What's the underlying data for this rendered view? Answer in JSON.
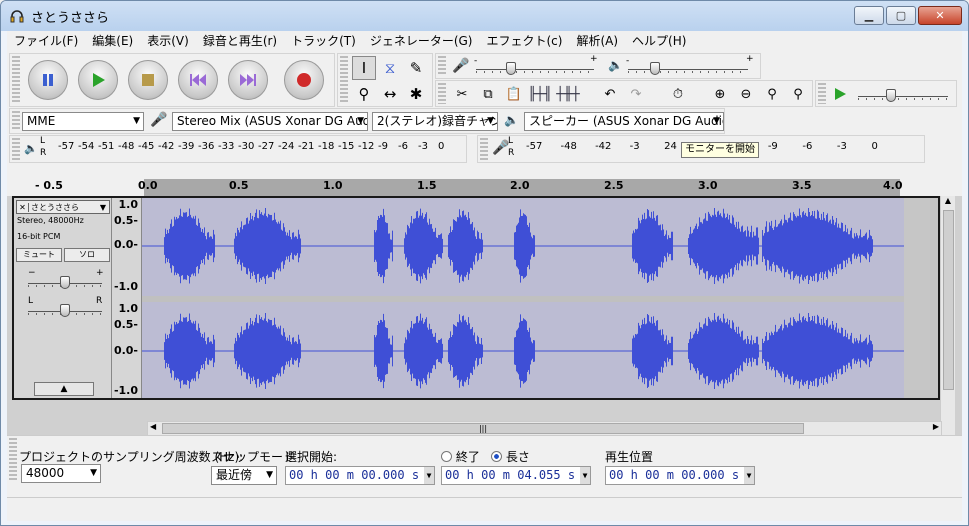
{
  "window": {
    "title": "さとうささら"
  },
  "menu": [
    "ファイル(F)",
    "編集(E)",
    "表示(V)",
    "録音と再生(r)",
    "トラック(T)",
    "ジェネレーター(G)",
    "エフェクト(c)",
    "解析(A)",
    "ヘルプ(H)"
  ],
  "meter_toolbar": {
    "mic_plus": "+",
    "mic_minus": "-",
    "out_plus": "+",
    "out_minus": "-"
  },
  "devices": {
    "host": "MME",
    "input": "Stereo Mix (ASUS Xonar DG Aud",
    "channels": "2(ステレオ)録音チャン",
    "output": "スピーカー (ASUS Xonar DG Audio"
  },
  "meters": {
    "rec_ticks": [
      "-57",
      "-54",
      "-51",
      "-48",
      "-45",
      "-42",
      "-39",
      "-36",
      "-33",
      "-30",
      "-27",
      "-24",
      "-21",
      "-18",
      "-15",
      "-12",
      "-9",
      "-6",
      "-3",
      "0"
    ],
    "play_ticks": [
      "-57",
      "-48",
      "-42",
      "-3",
      "24",
      "-18",
      "-12",
      "-9",
      "-6",
      "-3",
      "0"
    ],
    "L": "L",
    "R": "R",
    "tooltip": "モニターを開始"
  },
  "ruler": {
    "ticks": [
      "- 0.5",
      "0.0",
      "0.5",
      "1.0",
      "1.5",
      "2.0",
      "2.5",
      "3.0",
      "3.5",
      "4.0"
    ]
  },
  "track": {
    "name": "さとうささら",
    "info1": "Stereo, 48000Hz",
    "info2": "16-bit PCM",
    "mute": "ミュート",
    "solo": "ソロ",
    "gain_minus": "−",
    "gain_plus": "+",
    "pan_left": "L",
    "pan_right": "R",
    "scale": [
      "1.0",
      "0.5-",
      "0.0-",
      "-1.0"
    ],
    "scale2": [
      "1.0",
      "0.5-",
      "0.0-",
      "-1.0"
    ]
  },
  "selection": {
    "rate_label": "プロジェクトのサンプリング周波数 (Hz):",
    "rate_value": "48000",
    "snap_label": "スナップモード",
    "snap_value": "最近傍",
    "start_label": "選択開始:",
    "end_option": "終了",
    "length_option": "長さ",
    "start_value": "00 h 00 m 00.000 s",
    "length_value": "00 h 00 m 04.055 s",
    "pos_label": "再生位置",
    "pos_value": "00 h 00 m 00.000 s"
  },
  "colors": {
    "wave": "#3f4fd6",
    "wave_bg": "#bcbcd3"
  }
}
